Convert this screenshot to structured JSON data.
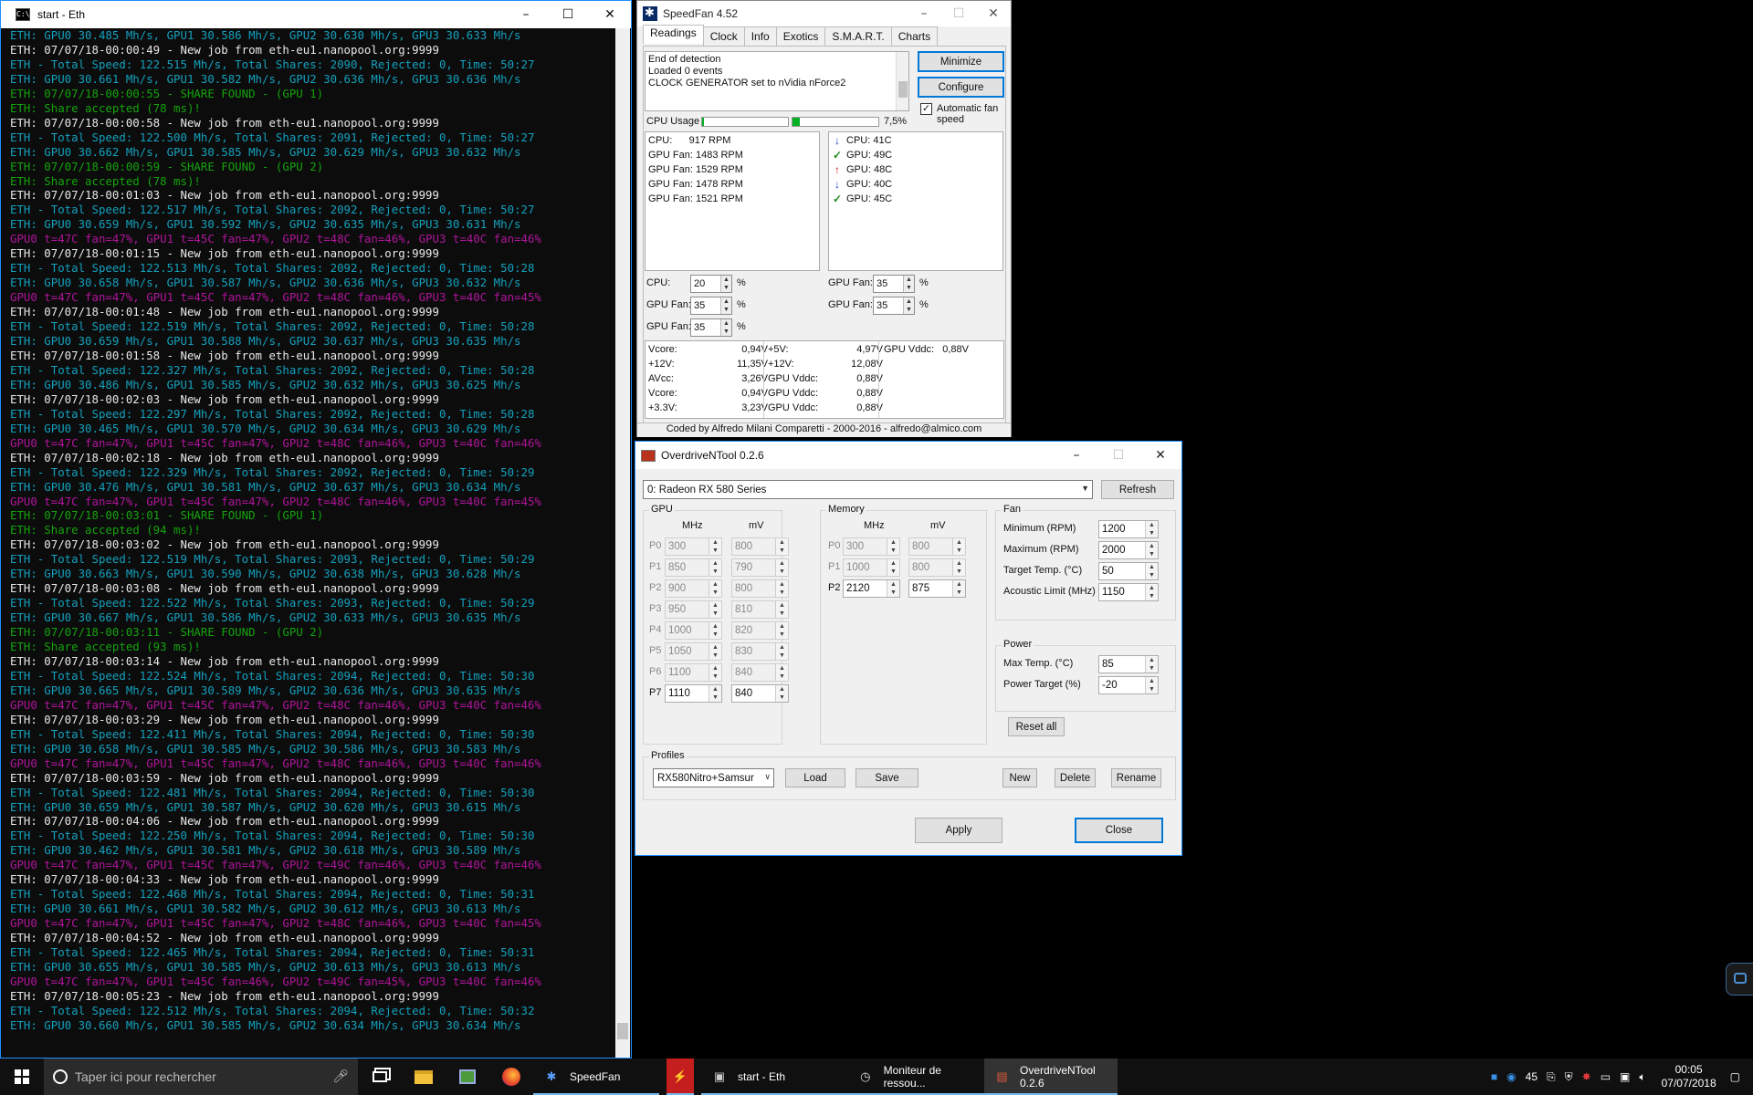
{
  "console": {
    "title": "start - Eth",
    "lines": [
      {
        "t": "ETH: GPU0 30.485 Mh/s, GPU1 30.586 Mh/s, GPU2 30.630 Mh/s, GPU3 30.633 Mh/s",
        "c": "cyan"
      },
      {
        "t": "ETH: 07/07/18-00:00:49 - New job from eth-eu1.nanopool.org:9999",
        "c": "white"
      },
      {
        "t": "ETH - Total Speed: 122.515 Mh/s, Total Shares: 2090, Rejected: 0, Time: 50:27",
        "c": "cyan"
      },
      {
        "t": "ETH: GPU0 30.661 Mh/s, GPU1 30.582 Mh/s, GPU2 30.636 Mh/s, GPU3 30.636 Mh/s",
        "c": "cyan"
      },
      {
        "t": "ETH: 07/07/18-00:00:55 - SHARE FOUND - (GPU 1)",
        "c": "green"
      },
      {
        "t": "ETH: Share accepted (78 ms)!",
        "c": "green"
      },
      {
        "t": "ETH: 07/07/18-00:00:58 - New job from eth-eu1.nanopool.org:9999",
        "c": "white"
      },
      {
        "t": "ETH - Total Speed: 122.500 Mh/s, Total Shares: 2091, Rejected: 0, Time: 50:27",
        "c": "cyan"
      },
      {
        "t": "ETH: GPU0 30.662 Mh/s, GPU1 30.585 Mh/s, GPU2 30.629 Mh/s, GPU3 30.632 Mh/s",
        "c": "cyan"
      },
      {
        "t": "ETH: 07/07/18-00:00:59 - SHARE FOUND - (GPU 2)",
        "c": "green"
      },
      {
        "t": "ETH: Share accepted (78 ms)!",
        "c": "green"
      },
      {
        "t": "ETH: 07/07/18-00:01:03 - New job from eth-eu1.nanopool.org:9999",
        "c": "white"
      },
      {
        "t": "ETH - Total Speed: 122.517 Mh/s, Total Shares: 2092, Rejected: 0, Time: 50:27",
        "c": "cyan"
      },
      {
        "t": "ETH: GPU0 30.659 Mh/s, GPU1 30.592 Mh/s, GPU2 30.635 Mh/s, GPU3 30.631 Mh/s",
        "c": "cyan"
      },
      {
        "t": "GPU0 t=47C fan=47%, GPU1 t=45C fan=47%, GPU2 t=48C fan=46%, GPU3 t=40C fan=46%",
        "c": "mag"
      },
      {
        "t": "ETH: 07/07/18-00:01:15 - New job from eth-eu1.nanopool.org:9999",
        "c": "white"
      },
      {
        "t": "ETH - Total Speed: 122.513 Mh/s, Total Shares: 2092, Rejected: 0, Time: 50:28",
        "c": "cyan"
      },
      {
        "t": "ETH: GPU0 30.658 Mh/s, GPU1 30.587 Mh/s, GPU2 30.636 Mh/s, GPU3 30.632 Mh/s",
        "c": "cyan"
      },
      {
        "t": "GPU0 t=47C fan=47%, GPU1 t=45C fan=47%, GPU2 t=48C fan=46%, GPU3 t=40C fan=45%",
        "c": "mag"
      },
      {
        "t": "ETH: 07/07/18-00:01:48 - New job from eth-eu1.nanopool.org:9999",
        "c": "white"
      },
      {
        "t": "ETH - Total Speed: 122.519 Mh/s, Total Shares: 2092, Rejected: 0, Time: 50:28",
        "c": "cyan"
      },
      {
        "t": "ETH: GPU0 30.659 Mh/s, GPU1 30.588 Mh/s, GPU2 30.637 Mh/s, GPU3 30.635 Mh/s",
        "c": "cyan"
      },
      {
        "t": "ETH: 07/07/18-00:01:58 - New job from eth-eu1.nanopool.org:9999",
        "c": "white"
      },
      {
        "t": "ETH - Total Speed: 122.327 Mh/s, Total Shares: 2092, Rejected: 0, Time: 50:28",
        "c": "cyan"
      },
      {
        "t": "ETH: GPU0 30.486 Mh/s, GPU1 30.585 Mh/s, GPU2 30.632 Mh/s, GPU3 30.625 Mh/s",
        "c": "cyan"
      },
      {
        "t": "ETH: 07/07/18-00:02:03 - New job from eth-eu1.nanopool.org:9999",
        "c": "white"
      },
      {
        "t": "ETH - Total Speed: 122.297 Mh/s, Total Shares: 2092, Rejected: 0, Time: 50:28",
        "c": "cyan"
      },
      {
        "t": "ETH: GPU0 30.465 Mh/s, GPU1 30.570 Mh/s, GPU2 30.634 Mh/s, GPU3 30.629 Mh/s",
        "c": "cyan"
      },
      {
        "t": "GPU0 t=47C fan=47%, GPU1 t=45C fan=47%, GPU2 t=48C fan=46%, GPU3 t=40C fan=46%",
        "c": "mag"
      },
      {
        "t": "ETH: 07/07/18-00:02:18 - New job from eth-eu1.nanopool.org:9999",
        "c": "white"
      },
      {
        "t": "ETH - Total Speed: 122.329 Mh/s, Total Shares: 2092, Rejected: 0, Time: 50:29",
        "c": "cyan"
      },
      {
        "t": "ETH: GPU0 30.476 Mh/s, GPU1 30.581 Mh/s, GPU2 30.637 Mh/s, GPU3 30.634 Mh/s",
        "c": "cyan"
      },
      {
        "t": "GPU0 t=47C fan=47%, GPU1 t=45C fan=47%, GPU2 t=48C fan=46%, GPU3 t=40C fan=45%",
        "c": "mag"
      },
      {
        "t": "ETH: 07/07/18-00:03:01 - SHARE FOUND - (GPU 1)",
        "c": "green"
      },
      {
        "t": "ETH: Share accepted (94 ms)!",
        "c": "green"
      },
      {
        "t": "ETH: 07/07/18-00:03:02 - New job from eth-eu1.nanopool.org:9999",
        "c": "white"
      },
      {
        "t": "ETH - Total Speed: 122.519 Mh/s, Total Shares: 2093, Rejected: 0, Time: 50:29",
        "c": "cyan"
      },
      {
        "t": "ETH: GPU0 30.663 Mh/s, GPU1 30.590 Mh/s, GPU2 30.638 Mh/s, GPU3 30.628 Mh/s",
        "c": "cyan"
      },
      {
        "t": "ETH: 07/07/18-00:03:08 - New job from eth-eu1.nanopool.org:9999",
        "c": "white"
      },
      {
        "t": "ETH - Total Speed: 122.522 Mh/s, Total Shares: 2093, Rejected: 0, Time: 50:29",
        "c": "cyan"
      },
      {
        "t": "ETH: GPU0 30.667 Mh/s, GPU1 30.586 Mh/s, GPU2 30.633 Mh/s, GPU3 30.635 Mh/s",
        "c": "cyan"
      },
      {
        "t": "ETH: 07/07/18-00:03:11 - SHARE FOUND - (GPU 2)",
        "c": "green"
      },
      {
        "t": "ETH: Share accepted (93 ms)!",
        "c": "green"
      },
      {
        "t": "ETH: 07/07/18-00:03:14 - New job from eth-eu1.nanopool.org:9999",
        "c": "white"
      },
      {
        "t": "ETH - Total Speed: 122.524 Mh/s, Total Shares: 2094, Rejected: 0, Time: 50:30",
        "c": "cyan"
      },
      {
        "t": "ETH: GPU0 30.665 Mh/s, GPU1 30.589 Mh/s, GPU2 30.636 Mh/s, GPU3 30.635 Mh/s",
        "c": "cyan"
      },
      {
        "t": "GPU0 t=47C fan=47%, GPU1 t=45C fan=47%, GPU2 t=48C fan=46%, GPU3 t=40C fan=46%",
        "c": "mag"
      },
      {
        "t": "ETH: 07/07/18-00:03:29 - New job from eth-eu1.nanopool.org:9999",
        "c": "white"
      },
      {
        "t": "ETH - Total Speed: 122.411 Mh/s, Total Shares: 2094, Rejected: 0, Time: 50:30",
        "c": "cyan"
      },
      {
        "t": "ETH: GPU0 30.658 Mh/s, GPU1 30.585 Mh/s, GPU2 30.586 Mh/s, GPU3 30.583 Mh/s",
        "c": "cyan"
      },
      {
        "t": "GPU0 t=47C fan=47%, GPU1 t=45C fan=47%, GPU2 t=48C fan=46%, GPU3 t=40C fan=46%",
        "c": "mag"
      },
      {
        "t": "ETH: 07/07/18-00:03:59 - New job from eth-eu1.nanopool.org:9999",
        "c": "white"
      },
      {
        "t": "ETH - Total Speed: 122.481 Mh/s, Total Shares: 2094, Rejected: 0, Time: 50:30",
        "c": "cyan"
      },
      {
        "t": "ETH: GPU0 30.659 Mh/s, GPU1 30.587 Mh/s, GPU2 30.620 Mh/s, GPU3 30.615 Mh/s",
        "c": "cyan"
      },
      {
        "t": "ETH: 07/07/18-00:04:06 - New job from eth-eu1.nanopool.org:9999",
        "c": "white"
      },
      {
        "t": "ETH - Total Speed: 122.250 Mh/s, Total Shares: 2094, Rejected: 0, Time: 50:30",
        "c": "cyan"
      },
      {
        "t": "ETH: GPU0 30.462 Mh/s, GPU1 30.581 Mh/s, GPU2 30.618 Mh/s, GPU3 30.589 Mh/s",
        "c": "cyan"
      },
      {
        "t": "GPU0 t=47C fan=47%, GPU1 t=45C fan=47%, GPU2 t=49C fan=46%, GPU3 t=40C fan=46%",
        "c": "mag"
      },
      {
        "t": "ETH: 07/07/18-00:04:33 - New job from eth-eu1.nanopool.org:9999",
        "c": "white"
      },
      {
        "t": "ETH - Total Speed: 122.468 Mh/s, Total Shares: 2094, Rejected: 0, Time: 50:31",
        "c": "cyan"
      },
      {
        "t": "ETH: GPU0 30.661 Mh/s, GPU1 30.582 Mh/s, GPU2 30.612 Mh/s, GPU3 30.613 Mh/s",
        "c": "cyan"
      },
      {
        "t": "GPU0 t=47C fan=47%, GPU1 t=45C fan=47%, GPU2 t=48C fan=46%, GPU3 t=40C fan=45%",
        "c": "mag"
      },
      {
        "t": "ETH: 07/07/18-00:04:52 - New job from eth-eu1.nanopool.org:9999",
        "c": "white"
      },
      {
        "t": "ETH - Total Speed: 122.465 Mh/s, Total Shares: 2094, Rejected: 0, Time: 50:31",
        "c": "cyan"
      },
      {
        "t": "ETH: GPU0 30.655 Mh/s, GPU1 30.585 Mh/s, GPU2 30.613 Mh/s, GPU3 30.613 Mh/s",
        "c": "cyan"
      },
      {
        "t": "GPU0 t=47C fan=47%, GPU1 t=45C fan=46%, GPU2 t=49C fan=45%, GPU3 t=40C fan=46%",
        "c": "mag"
      },
      {
        "t": "ETH: 07/07/18-00:05:23 - New job from eth-eu1.nanopool.org:9999",
        "c": "white"
      },
      {
        "t": "ETH - Total Speed: 122.512 Mh/s, Total Shares: 2094, Rejected: 0, Time: 50:32",
        "c": "cyan"
      },
      {
        "t": "ETH: GPU0 30.660 Mh/s, GPU1 30.585 Mh/s, GPU2 30.634 Mh/s, GPU3 30.634 Mh/s",
        "c": "cyan"
      }
    ]
  },
  "speedfan": {
    "title": "SpeedFan 4.52",
    "tabs": [
      "Readings",
      "Clock",
      "Info",
      "Exotics",
      "S.M.A.R.T.",
      "Charts"
    ],
    "log": [
      "End of detection",
      "Loaded 0 events",
      "CLOCK GENERATOR set to nVidia nForce2"
    ],
    "minimize_label": "Minimize",
    "configure_label": "Configure",
    "auto_fan_label": "Automatic fan speed",
    "cpu_usage_label": "CPU Usage",
    "cpu_usage_value": "7,5%",
    "cpu_bars": [
      0.02,
      0.09
    ],
    "fans": [
      "CPU:      917 RPM",
      "GPU Fan: 1483 RPM",
      "GPU Fan: 1529 RPM",
      "GPU Fan: 1478 RPM",
      "GPU Fan: 1521 RPM"
    ],
    "temps": [
      {
        "label": "CPU: 41C",
        "mark": "down"
      },
      {
        "label": "GPU: 49C",
        "mark": "ok"
      },
      {
        "label": "GPU: 48C",
        "mark": "up"
      },
      {
        "label": "GPU: 40C",
        "mark": "down"
      },
      {
        "label": "GPU: 45C",
        "mark": "ok"
      }
    ],
    "speed_controls": [
      {
        "label": "CPU:",
        "value": "20"
      },
      {
        "label": "GPU Fan:",
        "value": "35"
      },
      {
        "label": "GPU Fan:",
        "value": "35"
      },
      {
        "label": "GPU Fan:",
        "value": "35"
      },
      {
        "label": "GPU Fan:",
        "value": "35"
      }
    ],
    "percent_sign": "%",
    "volts_col1_labels": [
      "Vcore:",
      "+12V:",
      "AVcc:",
      "Vcore:",
      "+3.3V:"
    ],
    "volts_col1_values": [
      "0,94V",
      "11,35V",
      "3,26V",
      "0,94V",
      "3,23V"
    ],
    "volts_col2_labels": [
      "+5V:",
      "+12V:",
      "GPU Vddc:",
      "GPU Vddc:",
      "GPU Vddc:"
    ],
    "volts_col2_values": [
      "4,97V",
      "12,08V",
      "0,88V",
      "0,88V",
      "0,88V"
    ],
    "volts_col3_label": "GPU Vddc:",
    "volts_col3_value": "0,88V",
    "footer": "Coded by Alfredo Milani Comparetti - 2000-2016 - alfredo@almico.com"
  },
  "overdrive": {
    "title": "OverdriveNTool 0.2.6",
    "device": "0: Radeon RX 580 Series",
    "refresh_label": "Refresh",
    "gpu_group": "GPU",
    "mem_group": "Memory",
    "fan_group": "Fan",
    "power_group": "Power",
    "profiles_group": "Profiles",
    "mhz_header": "MHz",
    "mv_header": "mV",
    "gpu_states": [
      {
        "p": "P0",
        "mhz": "300",
        "mv": "800",
        "enabled": false
      },
      {
        "p": "P1",
        "mhz": "850",
        "mv": "790",
        "enabled": false
      },
      {
        "p": "P2",
        "mhz": "900",
        "mv": "800",
        "enabled": false
      },
      {
        "p": "P3",
        "mhz": "950",
        "mv": "810",
        "enabled": false
      },
      {
        "p": "P4",
        "mhz": "1000",
        "mv": "820",
        "enabled": false
      },
      {
        "p": "P5",
        "mhz": "1050",
        "mv": "830",
        "enabled": false
      },
      {
        "p": "P6",
        "mhz": "1100",
        "mv": "840",
        "enabled": false
      },
      {
        "p": "P7",
        "mhz": "1110",
        "mv": "840",
        "enabled": true
      }
    ],
    "mem_states": [
      {
        "p": "P0",
        "mhz": "300",
        "mv": "800",
        "enabled": false
      },
      {
        "p": "P1",
        "mhz": "1000",
        "mv": "800",
        "enabled": false
      },
      {
        "p": "P2",
        "mhz": "2120",
        "mv": "875",
        "enabled": true
      }
    ],
    "fan_rows": [
      {
        "label": "Minimum (RPM)",
        "value": "1200"
      },
      {
        "label": "Maximum (RPM)",
        "value": "2000"
      },
      {
        "label": "Target Temp. (°C)",
        "value": "50"
      },
      {
        "label": "Acoustic Limit (MHz)",
        "value": "1150"
      }
    ],
    "power_rows": [
      {
        "label": "Max Temp. (°C)",
        "value": "85"
      },
      {
        "label": "Power Target (%)",
        "value": "-20"
      }
    ],
    "reset_label": "Reset all",
    "profile_value": "RX580Nitro+Samsur",
    "load_label": "Load",
    "save_label": "Save",
    "new_label": "New",
    "delete_label": "Delete",
    "rename_label": "Rename",
    "apply_label": "Apply",
    "close_label": "Close"
  },
  "taskbar": {
    "search_placeholder": "Taper ici pour rechercher",
    "apps": [
      {
        "label": "SpeedFan",
        "icon": "speedfan-icon"
      },
      {
        "label": "",
        "icon": "lightning-icon"
      },
      {
        "label": "start - Eth",
        "icon": "console-icon"
      },
      {
        "label": "Moniteur de ressou...",
        "icon": "monitor-icon"
      },
      {
        "label": "OverdriveNTool 0.2.6",
        "icon": "overdrive-icon"
      }
    ],
    "tray_number": "45",
    "time": "00:05",
    "date": "07/07/2018"
  }
}
